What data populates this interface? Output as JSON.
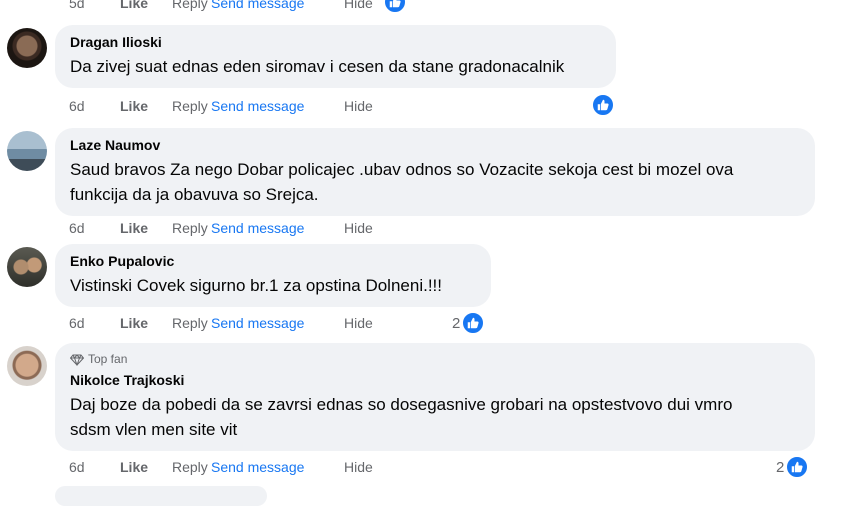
{
  "actions": {
    "like": "Like",
    "reply": "Reply",
    "send_message": "Send message",
    "hide": "Hide"
  },
  "top_row": {
    "time": "5d"
  },
  "comments": [
    {
      "author": "Dragan Ilioski",
      "text": "Da zivej suat ednas eden siromav i cesen da stane gradonacalnik",
      "time": "6d",
      "reaction_count": ""
    },
    {
      "author": "Laze Naumov",
      "text": "Saud bravos Za nego Dobar policajec .ubav odnos so Vozacite sekoja cest bi mozel ova\nfunkcija da ja obavuva so Srejca.",
      "time": "6d",
      "reaction_count": ""
    },
    {
      "author": "Enko Pupalovic",
      "text": "Vistinski Covek sigurno br.1 za opstina Dolneni.!!!",
      "time": "6d",
      "reaction_count": "2"
    },
    {
      "badge": "Top fan",
      "author": "Nikolce Trajkoski",
      "text": "Daj boze da pobedi da se zavrsi ednas so dosegasnive grobari na opstestvovo dui vmro\nsdsm vlen men site vit",
      "time": "6d",
      "reaction_count": "2"
    }
  ],
  "colors": {
    "link": "#1877f2",
    "secondary_text": "#65676b",
    "bubble": "#f0f2f5"
  },
  "icons": {
    "reaction": "like-thumb-icon",
    "badge": "diamond-icon"
  }
}
